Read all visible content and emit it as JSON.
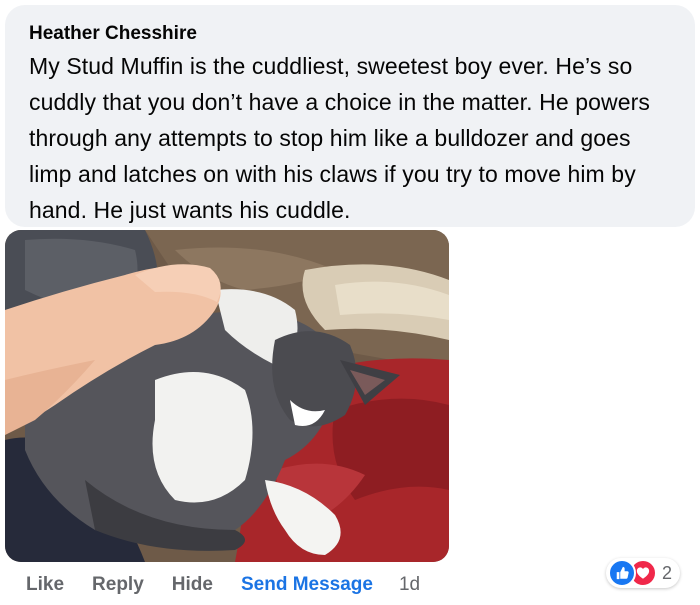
{
  "comment": {
    "author": "Heather Chesshire",
    "text": "My Stud Muffin is the cuddliest, sweetest boy ever. He’s so cuddly that you don’t have a choice in the matter. He powers through any attempts to stop him like a bulldozer and goes limp and latches on with his claws if you try to move him by hand. He just wants his cuddle."
  },
  "actions": {
    "like": "Like",
    "reply": "Reply",
    "hide": "Hide",
    "send_message": "Send Message",
    "timestamp": "1d"
  },
  "reactions": {
    "types": [
      "like-icon",
      "love-icon"
    ],
    "count": "2"
  },
  "colors": {
    "bubble_bg": "#f0f2f5",
    "action_gray": "#65676b",
    "link_blue": "#1b74e4",
    "like_blue": "#1877f2",
    "love_red": "#f0284a"
  }
}
